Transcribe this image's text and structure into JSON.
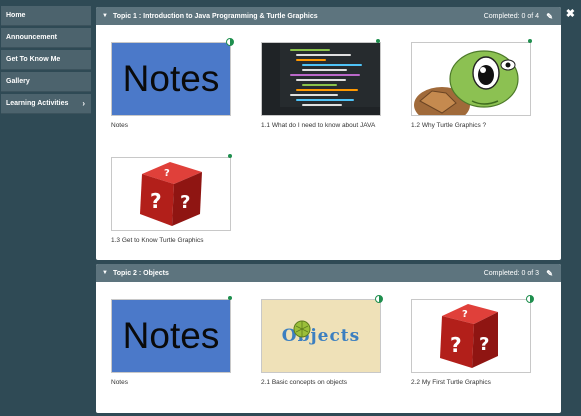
{
  "sidebar": {
    "items": [
      {
        "label": "Home"
      },
      {
        "label": "Announcement"
      },
      {
        "label": "Get To Know Me"
      },
      {
        "label": "Gallery"
      },
      {
        "label": "Learning Activities"
      }
    ]
  },
  "close_label": "✖",
  "topics": [
    {
      "title": "Topic 1 : Introduction to Java Programming & Turtle Graphics",
      "completed": "Completed: 0 of 4",
      "items": [
        {
          "caption": "Notes",
          "image": "notes-image",
          "status": "half"
        },
        {
          "caption": "1.1 What do I need to know about JAVA",
          "image": "code-screen-image",
          "status": "done"
        },
        {
          "caption": "1.2 Why Turtle Graphics ?",
          "image": "cartoon-turtle-image",
          "status": "done"
        },
        {
          "caption": "1.3 Get to Know Turtle Graphics",
          "image": "question-dice-image",
          "status": "done"
        }
      ]
    },
    {
      "title": "Topic 2 : Objects",
      "completed": "Completed: 0 of 3",
      "items": [
        {
          "caption": "Notes",
          "image": "notes-image",
          "status": "done"
        },
        {
          "caption": "2.1 Basic concepts on objects",
          "image": "objects-image",
          "status": "half"
        },
        {
          "caption": "2.2 My First Turtle Graphics",
          "image": "question-dice-image",
          "status": "half"
        }
      ]
    }
  ],
  "images": {
    "notes_text": "Notes",
    "objects_text": "Objects"
  },
  "colors": {
    "background": "#2f4a55",
    "sidebar_item": "#4c636d",
    "topic_header": "#5d747e",
    "status_green": "#1f8f4e",
    "notes_blue": "#4b79c9",
    "dice_red": "#c0221d"
  }
}
